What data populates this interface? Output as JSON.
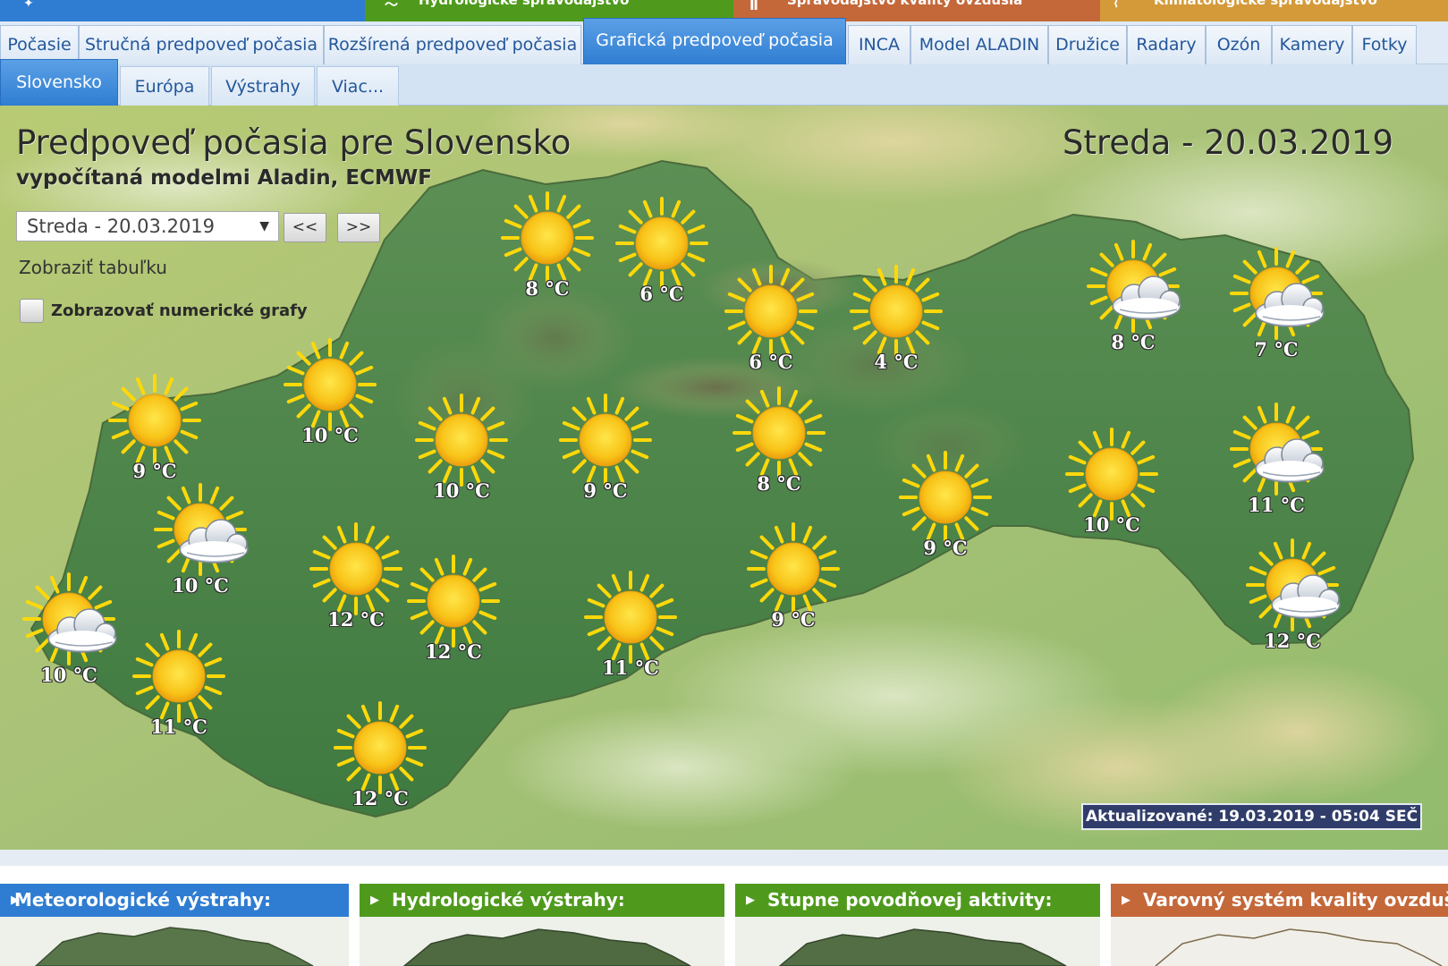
{
  "top_sections": [
    {
      "label": "Hydrologické spravodajstvo",
      "color": "#4f9a1c"
    },
    {
      "label": "Spravodajstvo kvality ovzdušia",
      "color": "#c4683a"
    },
    {
      "label": "Klimatologické spravodajstvo",
      "color": "#d49a3a"
    }
  ],
  "nav_main": [
    "Počasie",
    "Stručná predpoveď počasia",
    "Rozšírená predpoveď počasia",
    "Grafická predpoveď počasia",
    "INCA",
    "Model ALADIN",
    "Družice",
    "Radary",
    "Ozón",
    "Kamery",
    "Fotky"
  ],
  "nav_main_active": "Grafická predpoveď počasia",
  "nav_sub": [
    "Slovensko",
    "Európa",
    "Výstrahy",
    "Viac..."
  ],
  "nav_sub_active": "Slovensko",
  "map": {
    "title": "Predpoveď počasia pre Slovensko",
    "subtitle": "vypočítaná modelmi Aladin, ECMWF",
    "date_heading": "Streda - 20.03.2019",
    "date_select_value": "Streda - 20.03.2019",
    "prev_label": "<<",
    "next_label": ">>",
    "show_table_label": "Zobraziť tabuľku",
    "numeric_graphs_label": "Zobrazovať numerické grafy",
    "numeric_graphs_checked": false,
    "updated_label": "Aktualizované: 19.03.2019 - 05:04 SEČ",
    "stations": [
      {
        "temp": "10 °C",
        "icon": "sun-cloud-icon"
      },
      {
        "temp": "11 °C",
        "icon": "sun-icon"
      },
      {
        "temp": "9 °C",
        "icon": "sun-icon"
      },
      {
        "temp": "10 °C",
        "icon": "sun-cloud-icon"
      },
      {
        "temp": "10 °C",
        "icon": "sun-icon"
      },
      {
        "temp": "12 °C",
        "icon": "sun-icon"
      },
      {
        "temp": "12 °C",
        "icon": "sun-icon"
      },
      {
        "temp": "12 °C",
        "icon": "sun-icon"
      },
      {
        "temp": "10 °C",
        "icon": "sun-icon"
      },
      {
        "temp": "8 °C",
        "icon": "sun-icon"
      },
      {
        "temp": "6 °C",
        "icon": "sun-icon"
      },
      {
        "temp": "9 °C",
        "icon": "sun-icon"
      },
      {
        "temp": "11 °C",
        "icon": "sun-icon"
      },
      {
        "temp": "6 °C",
        "icon": "sun-icon"
      },
      {
        "temp": "4 °C",
        "icon": "sun-icon"
      },
      {
        "temp": "8 °C",
        "icon": "sun-icon"
      },
      {
        "temp": "9 °C",
        "icon": "sun-icon"
      },
      {
        "temp": "9 °C",
        "icon": "sun-icon"
      },
      {
        "temp": "10 °C",
        "icon": "sun-icon"
      },
      {
        "temp": "8 °C",
        "icon": "sun-cloud-icon"
      },
      {
        "temp": "7 °C",
        "icon": "sun-cloud-icon"
      },
      {
        "temp": "11 °C",
        "icon": "sun-cloud-icon"
      },
      {
        "temp": "12 °C",
        "icon": "sun-cloud-icon"
      }
    ]
  },
  "panels": [
    {
      "label": "Meteorologické výstrahy:",
      "color": "#2f7dd2"
    },
    {
      "label": "Hydrologické výstrahy:",
      "color": "#4f9a1c"
    },
    {
      "label": "Stupne povodňovej aktivity:",
      "color": "#4f9a1c"
    },
    {
      "label": "Varovný systém kvality ovzdušia:",
      "color": "#c4683a"
    }
  ]
}
